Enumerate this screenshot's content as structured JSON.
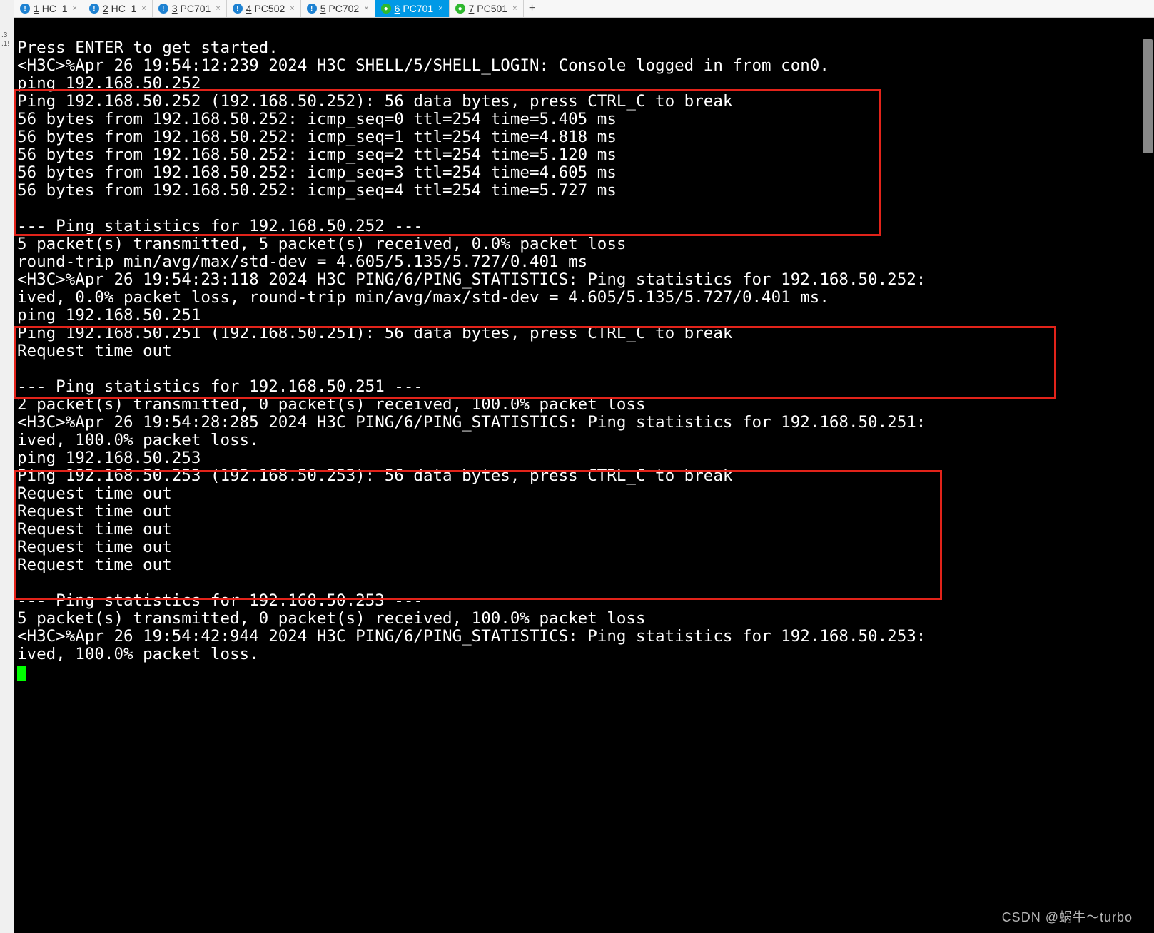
{
  "gutter": {
    "line1": ".3",
    "line2": ".1!"
  },
  "tabs": [
    {
      "num": "1",
      "label": "HC_1"
    },
    {
      "num": "2",
      "label": "HC_1"
    },
    {
      "num": "3",
      "label": "PC701"
    },
    {
      "num": "4",
      "label": "PC502"
    },
    {
      "num": "5",
      "label": "PC702"
    },
    {
      "num": "6",
      "label": "PC701"
    },
    {
      "num": "7",
      "label": "PC501"
    }
  ],
  "terminal": {
    "l0": "Press ENTER to get started.",
    "l1": "<H3C>%Apr 26 19:54:12:239 2024 H3C SHELL/5/SHELL_LOGIN: Console logged in from con0.",
    "l2": "ping 192.168.50.252",
    "l3": "Ping 192.168.50.252 (192.168.50.252): 56 data bytes, press CTRL_C to break",
    "l4": "56 bytes from 192.168.50.252: icmp_seq=0 ttl=254 time=5.405 ms",
    "l5": "56 bytes from 192.168.50.252: icmp_seq=1 ttl=254 time=4.818 ms",
    "l6": "56 bytes from 192.168.50.252: icmp_seq=2 ttl=254 time=5.120 ms",
    "l7": "56 bytes from 192.168.50.252: icmp_seq=3 ttl=254 time=4.605 ms",
    "l8": "56 bytes from 192.168.50.252: icmp_seq=4 ttl=254 time=5.727 ms",
    "l9": "",
    "l10": "--- Ping statistics for 192.168.50.252 ---",
    "l11": "5 packet(s) transmitted, 5 packet(s) received, 0.0% packet loss",
    "l12": "round-trip min/avg/max/std-dev = 4.605/5.135/5.727/0.401 ms",
    "l13": "<H3C>%Apr 26 19:54:23:118 2024 H3C PING/6/PING_STATISTICS: Ping statistics for 192.168.50.252:",
    "l14": "ived, 0.0% packet loss, round-trip min/avg/max/std-dev = 4.605/5.135/5.727/0.401 ms.",
    "l15": "ping 192.168.50.251",
    "l16": "Ping 192.168.50.251 (192.168.50.251): 56 data bytes, press CTRL_C to break",
    "l17": "Request time out",
    "l18": "",
    "l19": "--- Ping statistics for 192.168.50.251 ---",
    "l20": "2 packet(s) transmitted, 0 packet(s) received, 100.0% packet loss",
    "l21": "<H3C>%Apr 26 19:54:28:285 2024 H3C PING/6/PING_STATISTICS: Ping statistics for 192.168.50.251:",
    "l22": "ived, 100.0% packet loss.",
    "l23": "ping 192.168.50.253",
    "l24": "Ping 192.168.50.253 (192.168.50.253): 56 data bytes, press CTRL_C to break",
    "l25": "Request time out",
    "l26": "Request time out",
    "l27": "Request time out",
    "l28": "Request time out",
    "l29": "Request time out",
    "l30": "",
    "l31": "--- Ping statistics for 192.168.50.253 ---",
    "l32": "5 packet(s) transmitted, 0 packet(s) received, 100.0% packet loss",
    "l33": "<H3C>%Apr 26 19:54:42:944 2024 H3C PING/6/PING_STATISTICS: Ping statistics for 192.168.50.253:",
    "l34": "ived, 100.0% packet loss."
  },
  "watermark": "CSDN @蜗牛～turbo"
}
